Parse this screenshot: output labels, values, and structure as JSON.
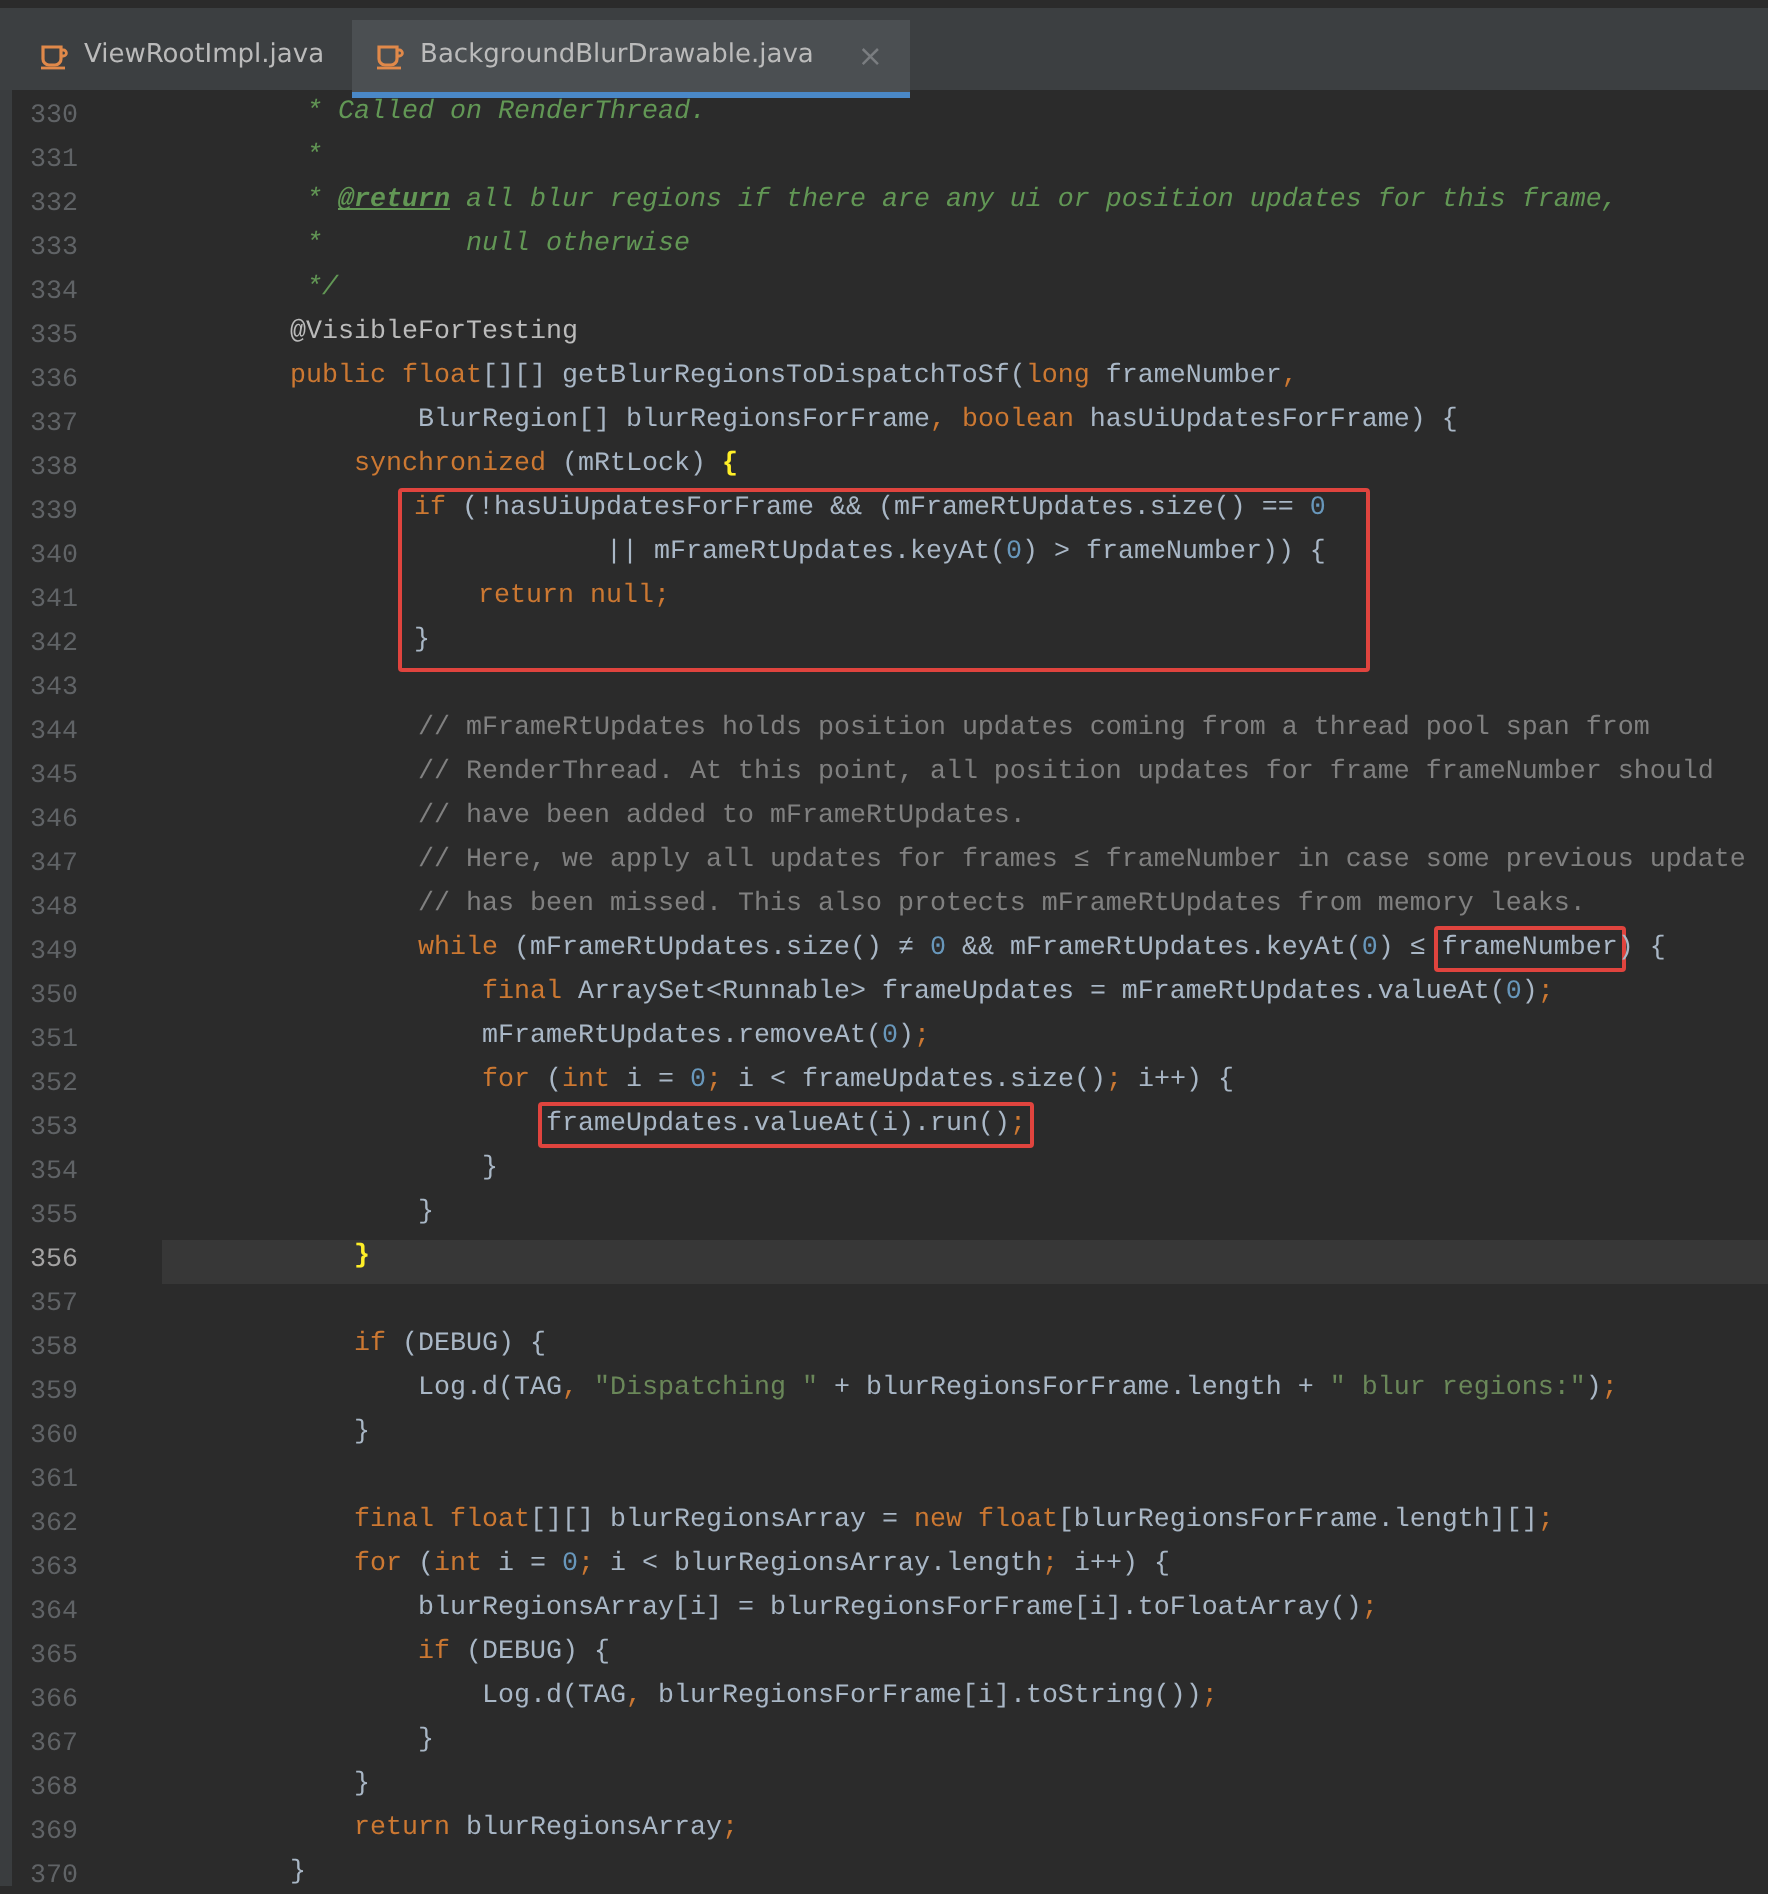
{
  "tabs": [
    {
      "label": "ViewRootImpl.java",
      "selected": false
    },
    {
      "label": "BackgroundBlurDrawable.java",
      "selected": true,
      "close": "×"
    }
  ],
  "editor": {
    "lines": [
      {
        "kind": "line",
        "number": "330",
        "current": false,
        "tokens": [
          {
            "kind": "doc",
            "text": "         * Called on RenderThread."
          }
        ]
      },
      {
        "kind": "line",
        "number": "331",
        "current": false,
        "tokens": [
          {
            "kind": "doc",
            "text": "         *"
          }
        ]
      },
      {
        "kind": "line",
        "number": "332",
        "current": false,
        "tokens": [
          {
            "kind": "doc",
            "text": "         * "
          },
          {
            "kind": "doctag",
            "text": "@return"
          },
          {
            "kind": "doc",
            "text": " all blur regions if there are any ui or position updates for this frame,"
          }
        ]
      },
      {
        "kind": "line",
        "number": "333",
        "current": false,
        "tokens": [
          {
            "kind": "doc",
            "text": "         *         null otherwise"
          }
        ]
      },
      {
        "kind": "line",
        "number": "334",
        "current": false,
        "tokens": [
          {
            "kind": "doc",
            "text": "         */"
          }
        ]
      },
      {
        "kind": "line",
        "number": "335",
        "current": false,
        "tokens": [
          {
            "kind": "annotation",
            "text": "        @VisibleForTesting"
          }
        ]
      },
      {
        "kind": "line",
        "number": "336",
        "current": false,
        "tokens": [
          {
            "kind": "keyword",
            "text": "        public float"
          },
          {
            "kind": "plain",
            "text": "[][] getBlurRegionsToDispatchToSf("
          },
          {
            "kind": "keyword",
            "text": "long"
          },
          {
            "kind": "plain",
            "text": " frameNumber"
          },
          {
            "kind": "keyword",
            "text": ","
          }
        ]
      },
      {
        "kind": "line",
        "number": "337",
        "current": false,
        "tokens": [
          {
            "kind": "plain",
            "text": "                BlurRegion[] blurRegionsForFrame"
          },
          {
            "kind": "keyword",
            "text": ", boolean"
          },
          {
            "kind": "plain",
            "text": " hasUiUpdatesForFrame) {"
          }
        ]
      },
      {
        "kind": "line",
        "number": "338",
        "current": false,
        "tokens": [
          {
            "kind": "keyword",
            "text": "            synchronized"
          },
          {
            "kind": "plain",
            "text": " (mRtLock) "
          },
          {
            "kind": "match",
            "text": "{"
          }
        ]
      },
      {
        "kind": "box",
        "lines": [
          {
            "kind": "line",
            "number": "339",
            "current": false,
            "tokens": [
              {
                "kind": "keyword",
                "text": "                if"
              },
              {
                "kind": "plain",
                "text": " (!hasUiUpdatesForFrame && (mFrameRtUpdates.size() == "
              },
              {
                "kind": "number",
                "text": "0"
              }
            ]
          },
          {
            "kind": "line",
            "number": "340",
            "current": false,
            "tokens": [
              {
                "kind": "plain",
                "text": "                            || mFrameRtUpdates.keyAt("
              },
              {
                "kind": "number",
                "text": "0"
              },
              {
                "kind": "plain",
                "text": ") > frameNumber)) {"
              }
            ]
          },
          {
            "kind": "line",
            "number": "341",
            "current": false,
            "tokens": [
              {
                "kind": "keyword",
                "text": "                    return null;"
              }
            ]
          },
          {
            "kind": "line",
            "number": "342",
            "current": false,
            "tokens": [
              {
                "kind": "plain",
                "text": "                }"
              }
            ]
          }
        ]
      },
      {
        "kind": "line",
        "number": "343",
        "current": false
      },
      {
        "kind": "line",
        "number": "344",
        "current": false,
        "tokens": [
          {
            "kind": "comment",
            "text": "                // mFrameRtUpdates holds position updates coming from a thread pool span from"
          }
        ]
      },
      {
        "kind": "line",
        "number": "345",
        "current": false,
        "tokens": [
          {
            "kind": "comment",
            "text": "                // RenderThread. At this point, all position updates for frame frameNumber should"
          }
        ]
      },
      {
        "kind": "line",
        "number": "346",
        "current": false,
        "tokens": [
          {
            "kind": "comment",
            "text": "                // have been added to mFrameRtUpdates."
          }
        ]
      },
      {
        "kind": "line",
        "number": "347",
        "current": false,
        "tokens": [
          {
            "kind": "comment",
            "text": "                // Here, we apply all updates for frames ≤ frameNumber in case some previous update"
          }
        ]
      },
      {
        "kind": "line",
        "number": "348",
        "current": false,
        "tokens": [
          {
            "kind": "comment",
            "text": "                // has been missed. This also protects mFrameRtUpdates from memory leaks."
          }
        ]
      },
      {
        "kind": "line",
        "number": "349",
        "current": false,
        "tokens": [
          {
            "kind": "keyword",
            "text": "                while"
          },
          {
            "kind": "plain",
            "text": " (mFrameRtUpdates.size() ≠ "
          },
          {
            "kind": "number",
            "text": "0"
          },
          {
            "kind": "plain",
            "text": " && mFrameRtUpdates.keyAt("
          },
          {
            "kind": "number",
            "text": "0"
          },
          {
            "kind": "plain",
            "text": ") ≤ "
          },
          {
            "kind": "box",
            "tokens": [
              {
                "kind": "plain",
                "text": "frameNumber"
              }
            ]
          },
          {
            "kind": "plain",
            "text": ") {"
          }
        ]
      },
      {
        "kind": "line",
        "number": "350",
        "current": false,
        "tokens": [
          {
            "kind": "keyword",
            "text": "                    final"
          },
          {
            "kind": "plain",
            "text": " ArraySet<Runnable> frameUpdates = mFrameRtUpdates.valueAt("
          },
          {
            "kind": "number",
            "text": "0"
          },
          {
            "kind": "plain",
            "text": ")"
          },
          {
            "kind": "keyword",
            "text": ";"
          }
        ]
      },
      {
        "kind": "line",
        "number": "351",
        "current": false,
        "tokens": [
          {
            "kind": "plain",
            "text": "                    mFrameRtUpdates.removeAt("
          },
          {
            "kind": "number",
            "text": "0"
          },
          {
            "kind": "plain",
            "text": ")"
          },
          {
            "kind": "keyword",
            "text": ";"
          }
        ]
      },
      {
        "kind": "line",
        "number": "352",
        "current": false,
        "tokens": [
          {
            "kind": "keyword",
            "text": "                    for"
          },
          {
            "kind": "plain",
            "text": " ("
          },
          {
            "kind": "keyword",
            "text": "int"
          },
          {
            "kind": "plain",
            "text": " i = "
          },
          {
            "kind": "number",
            "text": "0"
          },
          {
            "kind": "keyword",
            "text": ";"
          },
          {
            "kind": "plain",
            "text": " i < frameUpdates.size()"
          },
          {
            "kind": "keyword",
            "text": ";"
          },
          {
            "kind": "plain",
            "text": " i++) {"
          }
        ]
      },
      {
        "kind": "line",
        "number": "353",
        "current": false,
        "tokens": [
          {
            "kind": "box",
            "tokens": [
              {
                "kind": "plain",
                "text": "                        frameUpdates.valueAt(i).run()"
              },
              {
                "kind": "keyword",
                "text": ";"
              }
            ]
          }
        ]
      },
      {
        "kind": "line",
        "number": "354",
        "current": false,
        "tokens": [
          {
            "kind": "plain",
            "text": "                    }"
          }
        ]
      },
      {
        "kind": "line",
        "number": "355",
        "current": false,
        "tokens": [
          {
            "kind": "plain",
            "text": "                }"
          }
        ]
      },
      {
        "kind": "line",
        "number": "356",
        "current": true,
        "tokens": [
          {
            "kind": "match",
            "text": "            }"
          }
        ]
      },
      {
        "kind": "line",
        "number": "357",
        "current": false
      },
      {
        "kind": "line",
        "number": "358",
        "current": false,
        "tokens": [
          {
            "kind": "keyword",
            "text": "            if"
          },
          {
            "kind": "plain",
            "text": " (DEBUG) {"
          }
        ]
      },
      {
        "kind": "line",
        "number": "359",
        "current": false,
        "tokens": [
          {
            "kind": "plain",
            "text": "                Log.d(TAG"
          },
          {
            "kind": "keyword",
            "text": ","
          },
          {
            "kind": "string",
            "text": " \"Dispatching \""
          },
          {
            "kind": "plain",
            "text": " + blurRegionsForFrame.length + "
          },
          {
            "kind": "string",
            "text": "\" blur regions:\""
          },
          {
            "kind": "plain",
            "text": ")"
          },
          {
            "kind": "keyword",
            "text": ";"
          }
        ]
      },
      {
        "kind": "line",
        "number": "360",
        "current": false,
        "tokens": [
          {
            "kind": "plain",
            "text": "            }"
          }
        ]
      },
      {
        "kind": "line",
        "number": "361",
        "current": false
      },
      {
        "kind": "line",
        "number": "362",
        "current": false,
        "tokens": [
          {
            "kind": "keyword",
            "text": "            final float"
          },
          {
            "kind": "plain",
            "text": "[][] blurRegionsArray = "
          },
          {
            "kind": "keyword",
            "text": "new float"
          },
          {
            "kind": "plain",
            "text": "[blurRegionsForFrame.length][]"
          },
          {
            "kind": "keyword",
            "text": ";"
          }
        ]
      },
      {
        "kind": "line",
        "number": "363",
        "current": false,
        "tokens": [
          {
            "kind": "keyword",
            "text": "            for"
          },
          {
            "kind": "plain",
            "text": " ("
          },
          {
            "kind": "keyword",
            "text": "int"
          },
          {
            "kind": "plain",
            "text": " i = "
          },
          {
            "kind": "number",
            "text": "0"
          },
          {
            "kind": "keyword",
            "text": ";"
          },
          {
            "kind": "plain",
            "text": " i < blurRegionsArray.length"
          },
          {
            "kind": "keyword",
            "text": ";"
          },
          {
            "kind": "plain",
            "text": " i++) {"
          }
        ]
      },
      {
        "kind": "line",
        "number": "364",
        "current": false,
        "tokens": [
          {
            "kind": "plain",
            "text": "                blurRegionsArray[i] = blurRegionsForFrame[i].toFloatArray()"
          },
          {
            "kind": "keyword",
            "text": ";"
          }
        ]
      },
      {
        "kind": "line",
        "number": "365",
        "current": false,
        "tokens": [
          {
            "kind": "keyword",
            "text": "                if"
          },
          {
            "kind": "plain",
            "text": " (DEBUG) {"
          }
        ]
      },
      {
        "kind": "line",
        "number": "366",
        "current": false,
        "tokens": [
          {
            "kind": "plain",
            "text": "                    Log.d(TAG"
          },
          {
            "kind": "keyword",
            "text": ","
          },
          {
            "kind": "plain",
            "text": " blurRegionsForFrame[i].toString())"
          },
          {
            "kind": "keyword",
            "text": ";"
          }
        ]
      },
      {
        "kind": "line",
        "number": "367",
        "current": false,
        "tokens": [
          {
            "kind": "plain",
            "text": "                }"
          }
        ]
      },
      {
        "kind": "line",
        "number": "368",
        "current": false,
        "tokens": [
          {
            "kind": "plain",
            "text": "            }"
          }
        ]
      },
      {
        "kind": "line",
        "number": "369",
        "current": false,
        "tokens": [
          {
            "kind": "keyword",
            "text": "            return"
          },
          {
            "kind": "plain",
            "text": " blurRegionsArray"
          },
          {
            "kind": "keyword",
            "text": ";"
          }
        ]
      },
      {
        "kind": "line",
        "number": "370",
        "current": false,
        "tokens": [
          {
            "kind": "plain",
            "text": "        }"
          }
        ]
      }
    ]
  }
}
